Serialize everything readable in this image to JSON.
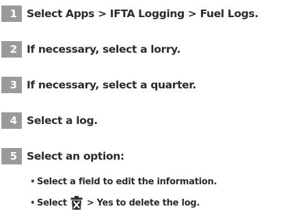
{
  "steps": [
    {
      "number": "1",
      "text": "Select Apps > IFTA Logging > Fuel Logs."
    },
    {
      "number": "2",
      "text": "If necessary, select a lorry."
    },
    {
      "number": "3",
      "text": "If necessary, select a quarter."
    },
    {
      "number": "4",
      "text": "Select a log."
    },
    {
      "number": "5",
      "text": "Select an option:"
    }
  ],
  "options": {
    "bullet": "•",
    "edit": "Select a field to edit the information.",
    "delete_prefix": "Select",
    "delete_middle": ">",
    "delete_yes": "Yes",
    "delete_suffix": "to delete the log.",
    "delete_icon": "trash-delete-icon"
  }
}
